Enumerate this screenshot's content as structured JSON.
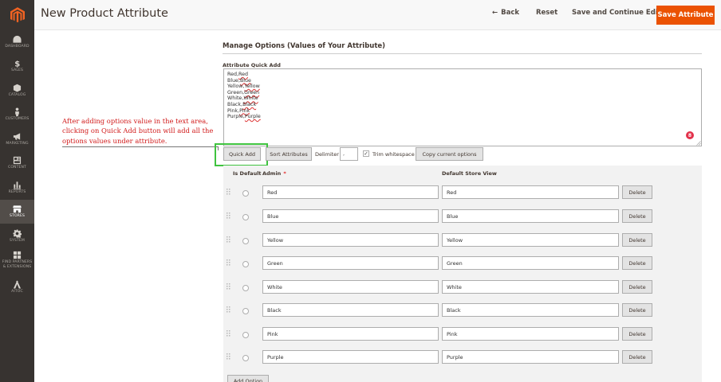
{
  "header": {
    "title": "New Product Attribute",
    "back_label": "Back",
    "back_arrow": "←",
    "reset_label": "Reset",
    "save_continue_label": "Save and Continue Edit",
    "save_attribute_label": "Save Attribute"
  },
  "sidebar": {
    "items": [
      {
        "label": "DASHBOARD",
        "icon": "dashboard-icon"
      },
      {
        "label": "SALES",
        "icon": "dollar-icon"
      },
      {
        "label": "CATALOG",
        "icon": "catalog-box-icon"
      },
      {
        "label": "CUSTOMERS",
        "icon": "person-icon"
      },
      {
        "label": "MARKETING",
        "icon": "megaphone-icon"
      },
      {
        "label": "CONTENT",
        "icon": "content-grid-icon"
      },
      {
        "label": "REPORTS",
        "icon": "bar-chart-icon"
      },
      {
        "label": "STORES",
        "icon": "store-icon",
        "active": true
      },
      {
        "label": "SYSTEM",
        "icon": "gear-icon"
      },
      {
        "label": "FIND PARTNERS",
        "label2": "& EXTENSIONS",
        "icon": "extensions-icon"
      },
      {
        "label": "AITOC",
        "icon": "aitoc-logo-icon"
      }
    ]
  },
  "section": {
    "title": "Manage Options (Values of Your Attribute)",
    "quick_add_label": "Attribute Quick Add",
    "textarea_lines": [
      {
        "a": "Red",
        "b": "Red"
      },
      {
        "a": "Blue",
        "b": "Blue"
      },
      {
        "a": "Yellow",
        "b": "Yellow"
      },
      {
        "a": "Green",
        "b": "Green"
      },
      {
        "a": "White",
        "b": "White"
      },
      {
        "a": "Black",
        "b": "Black"
      },
      {
        "a": "Pink",
        "b": "Pink"
      },
      {
        "a": "Purple",
        "b": "Purple"
      }
    ],
    "grammarly_count": "8"
  },
  "annotation": {
    "line1": "After adding options value in the text area,",
    "line2": "clicking on Quick Add button will add all the",
    "line3": "options values under attribute."
  },
  "toolbar": {
    "quick_add": "Quick Add",
    "sort_attributes": "Sort Attributes",
    "delimiter_label": "Delimiter",
    "delimiter_value": ",",
    "trim_checked": "✓",
    "trim_label": "Trim whitespace",
    "copy_options": "Copy current options"
  },
  "table": {
    "col_default": "Is Default",
    "col_admin": "Admin",
    "col_admin_required": "*",
    "col_store": "Default Store View",
    "delete_label": "Delete",
    "add_option_label": "Add Option",
    "rows": [
      {
        "admin": "Red",
        "store": "Red"
      },
      {
        "admin": "Blue",
        "store": "Blue"
      },
      {
        "admin": "Yellow",
        "store": "Yellow"
      },
      {
        "admin": "Green",
        "store": "Green"
      },
      {
        "admin": "White",
        "store": "White"
      },
      {
        "admin": "Black",
        "store": "Black"
      },
      {
        "admin": "Pink",
        "store": "Pink"
      },
      {
        "admin": "Purple",
        "store": "Purple"
      }
    ]
  },
  "colors": {
    "accent": "#eb5202",
    "sidebar": "#373330",
    "highlight": "#3fc33f",
    "annotation": "#d11a1a"
  }
}
